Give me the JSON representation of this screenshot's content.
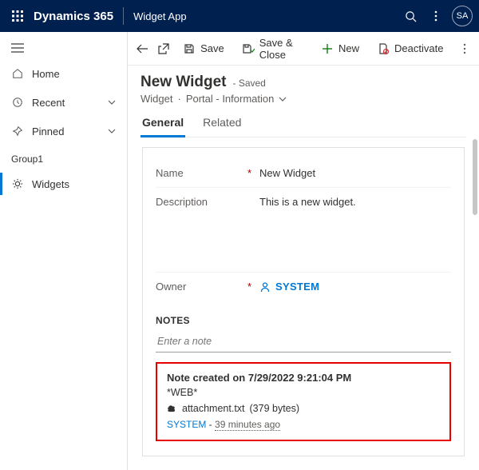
{
  "topbar": {
    "brand": "Dynamics 365",
    "app": "Widget App",
    "avatar": "SA"
  },
  "sidebar": {
    "items": [
      {
        "label": "Home"
      },
      {
        "label": "Recent"
      },
      {
        "label": "Pinned"
      }
    ],
    "group_label": "Group1",
    "group_items": [
      {
        "label": "Widgets"
      }
    ]
  },
  "commands": {
    "save": "Save",
    "save_close": "Save & Close",
    "new": "New",
    "deactivate": "Deactivate"
  },
  "header": {
    "title": "New Widget",
    "status": "- Saved",
    "entity": "Widget",
    "form": "Portal - Information"
  },
  "tabs": {
    "general": "General",
    "related": "Related"
  },
  "form": {
    "name_label": "Name",
    "name_value": "New Widget",
    "desc_label": "Description",
    "desc_value": "This is a new widget.",
    "owner_label": "Owner",
    "owner_value": "SYSTEM"
  },
  "notes": {
    "heading": "NOTES",
    "placeholder": "Enter a note",
    "note_title": "Note created on 7/29/2022 9:21:04 PM",
    "note_body": "*WEB*",
    "attachment_name": "attachment.txt",
    "attachment_size": "(379 bytes)",
    "author": "SYSTEM",
    "sep": " - ",
    "age": "39 minutes ago"
  }
}
